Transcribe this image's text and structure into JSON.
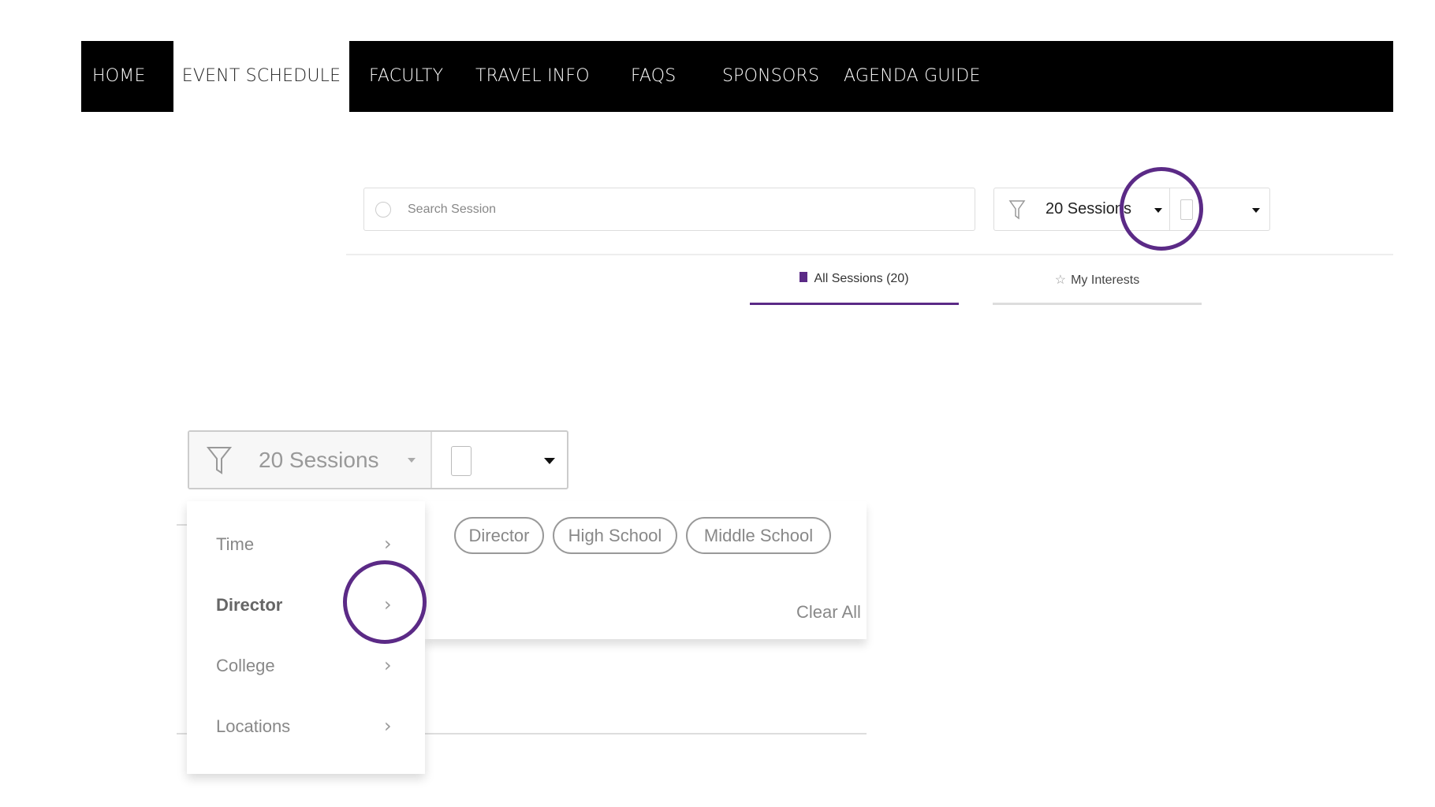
{
  "nav": {
    "items": [
      "HOME",
      "EVENT SCHEDULE",
      "FACULTY",
      "TRAVEL INFO",
      "FAQS",
      "SPONSORS",
      "AGENDA GUIDE"
    ],
    "active": "EVENT SCHEDULE"
  },
  "search": {
    "placeholder": "Search Session"
  },
  "filter": {
    "label": "20 Sessions"
  },
  "tabs": [
    {
      "label": "All Sessions (20)",
      "icon": "bookmark-icon",
      "active": true
    },
    {
      "label": "My Interests",
      "icon": "star-icon"
    }
  ],
  "zoomed": {
    "filter_label": "20 Sessions",
    "menu": [
      "Time",
      "Director",
      "College",
      "Locations"
    ],
    "chips": [
      "Director",
      "High School",
      "Middle School"
    ],
    "clear_all": "Clear All"
  },
  "colors": {
    "accent": "#5b2a86",
    "nav_bg": "#000000"
  }
}
